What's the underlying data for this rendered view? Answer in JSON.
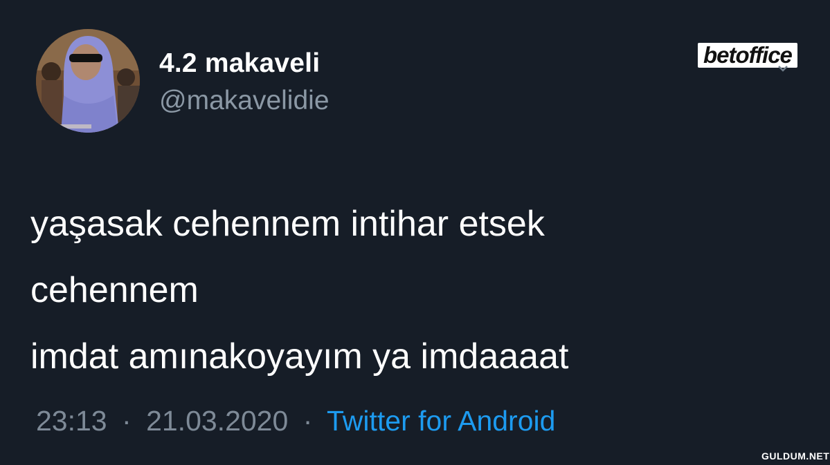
{
  "tweet": {
    "author": {
      "display_name": "4.2 makaveli",
      "handle": "@makavelidie"
    },
    "text_lines": [
      "yaşasak cehennem intihar etsek",
      "cehennem",
      "imdat amınakoyayım ya imdaaaat"
    ],
    "time": "23:13",
    "date": "21.03.2020",
    "separator": "·",
    "source": "Twitter for Android"
  },
  "overlay": {
    "brand_logo": "betoffice",
    "watermark": "GULDUM.NET"
  },
  "icons": {
    "avatar": "avatar",
    "menu": "chevron-down-icon"
  },
  "colors": {
    "background": "#161d27",
    "text_primary": "#ffffff",
    "text_secondary": "#8b98a5",
    "link": "#1d9bf0"
  }
}
